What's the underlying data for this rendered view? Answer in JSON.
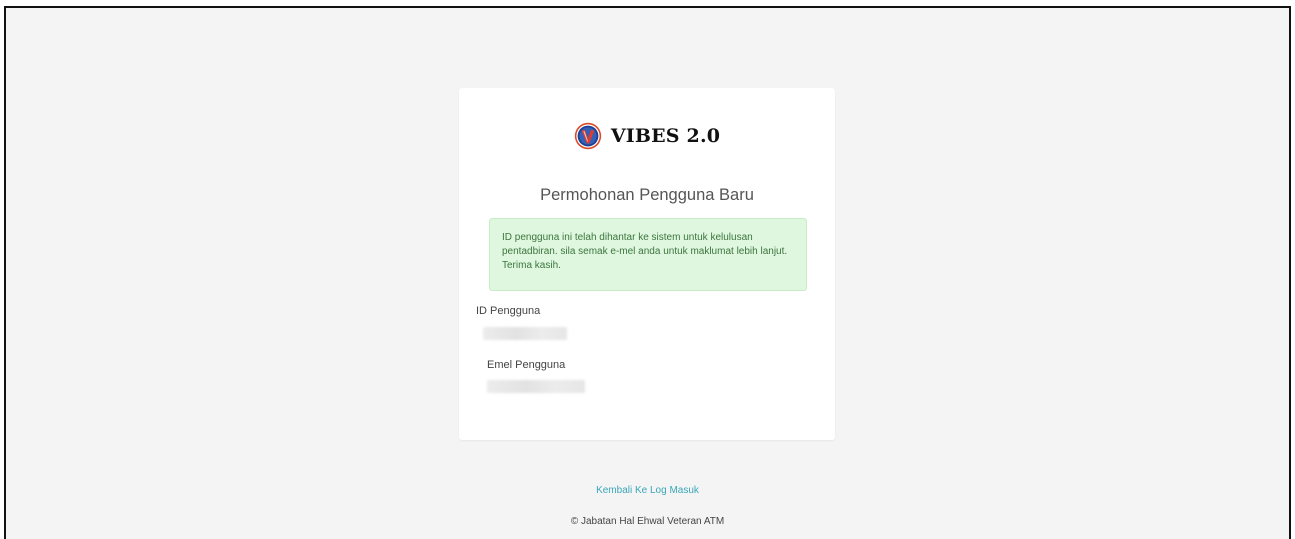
{
  "app": {
    "name": "VIBES 2.0",
    "logo_icon": "vibes-emblem-icon"
  },
  "page": {
    "title": "Permohonan Pengguna Baru"
  },
  "alert": {
    "message": "ID pengguna ini telah dihantar ke sistem untuk kelulusan pentadbiran. sila semak e-mel anda untuk maklumat lebih lanjut. Terima kasih.",
    "type": "success"
  },
  "fields": {
    "user_id_label": "ID Pengguna",
    "user_email_label": "Emel Pengguna"
  },
  "links": {
    "back_to_login": "Kembali Ke Log Masuk"
  },
  "footer": {
    "copyright": "© Jabatan Hal Ehwal Veteran ATM"
  },
  "colors": {
    "background": "#f4f4f4",
    "card": "#ffffff",
    "alert_bg": "#dff6df",
    "alert_text": "#3c763d",
    "link": "#3aa6b9",
    "title_text": "#555555"
  }
}
